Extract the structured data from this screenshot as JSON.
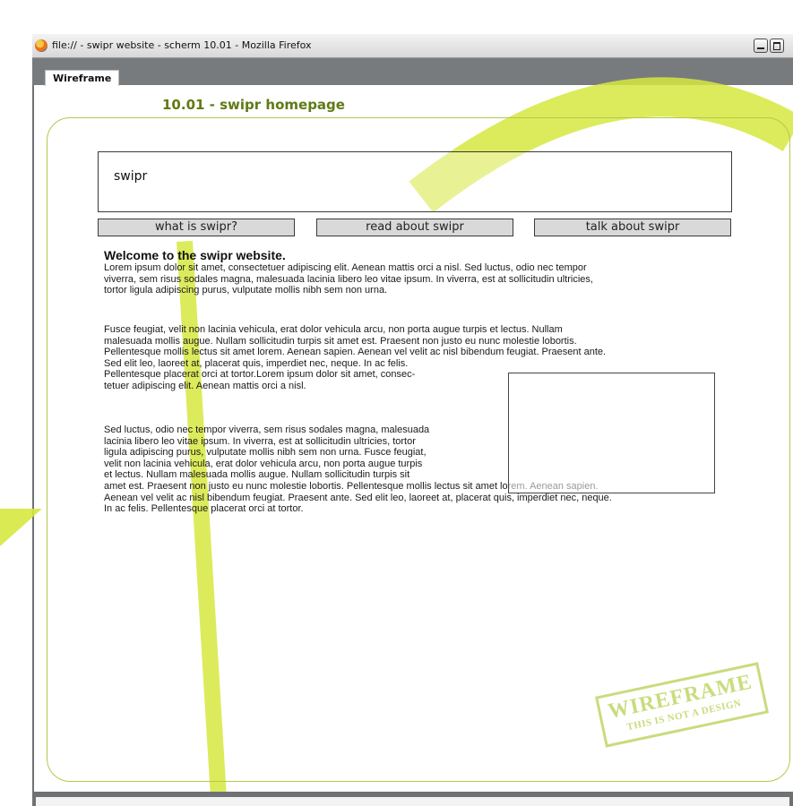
{
  "window": {
    "title": "file:// - swipr website - scherm 10.01 - Mozilla Firefox"
  },
  "tabs": [
    {
      "label": "Wireframe",
      "active": true
    }
  ],
  "page": {
    "title": "10.01 - swipr homepage"
  },
  "header": {
    "logo_text": "swipr"
  },
  "nav": {
    "items": [
      {
        "label": "what is swipr?"
      },
      {
        "label": "read about swipr"
      },
      {
        "label": "talk about swipr"
      }
    ]
  },
  "article": {
    "heading": "Welcome to the swipr website.",
    "paragraph_1": "Lorem ipsum dolor sit amet, consectetuer adipiscing elit. Aenean mattis orci a nisl. Sed luctus, odio nec tempor\nviverra, sem risus sodales magna, malesuada lacinia libero leo vitae ipsum. In viverra, est at sollicitudin ultricies,\ntortor ligula adipiscing purus, vulputate mollis nibh sem non urna.",
    "paragraph_2": "Fusce feugiat, velit non lacinia vehicula, erat dolor vehicula arcu, non porta augue turpis et lectus. Nullam\nmalesuada mollis augue. Nullam sollicitudin turpis sit amet est. Praesent non justo eu nunc molestie lobortis.\nPellentesque mollis lectus sit amet lorem. Aenean sapien. Aenean vel velit ac nisl bibendum feugiat. Praesent ante.\nSed elit leo, laoreet at, placerat quis, imperdiet nec, neque. In ac felis.\nPellentesque placerat orci at tortor.Lorem ipsum dolor sit amet, consec-\ntetuer adipiscing elit. Aenean mattis orci a nisl.",
    "paragraph_3": "Sed luctus, odio nec tempor viverra, sem risus sodales magna, malesuada\nlacinia libero leo vitae ipsum. In viverra, est at sollicitudin ultricies, tortor\nligula adipiscing purus, vulputate mollis nibh sem non urna. Fusce feugiat,\nvelit non lacinia vehicula, erat dolor vehicula arcu, non porta augue turpis\net lectus. Nullam malesuada mollis augue. Nullam sollicitudin turpis sit\namet est. Praesent non justo eu nunc molestie lobortis. Pellentesque mollis lectus sit amet lorem. Aenean sapien.\nAenean vel velit ac nisl bibendum feugiat. Praesent ante. Sed elit leo, laoreet at, placerat quis, imperdiet nec, neque.\nIn ac felis. Pellentesque placerat orci at tortor."
  },
  "stamp": {
    "title": "WIREFRAME",
    "subtitle": "THIS IS NOT A DESIGN"
  },
  "colors": {
    "accent_green": "#d6e83f",
    "title_green": "#607a14",
    "frame_green": "#b3c94a",
    "chrome_gray": "#777b7e"
  }
}
